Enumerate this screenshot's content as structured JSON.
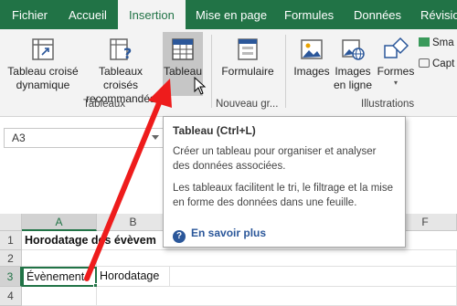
{
  "tabs": [
    {
      "label": "Fichier"
    },
    {
      "label": "Accueil"
    },
    {
      "label": "Insertion"
    },
    {
      "label": "Mise en page"
    },
    {
      "label": "Formules"
    },
    {
      "label": "Données"
    },
    {
      "label": "Révision"
    }
  ],
  "ribbon": {
    "pivot_label_1": "Tableau croisé",
    "pivot_label_2": "dynamique",
    "recommended_label_1": "Tableaux croisés",
    "recommended_label_2": "recommandés",
    "table_label": "Tableau",
    "group_tables": "Tableaux",
    "form_label": "Formulaire",
    "group_new": "Nouveau gr...",
    "images_label": "Images",
    "online_label_1": "Images",
    "online_label_2": "en ligne",
    "shapes_label": "Formes",
    "smartart_label": "Sma",
    "capture_label": "Capt",
    "group_illustrations": "Illustrations",
    "accent_color": "#217346"
  },
  "namebox": {
    "value": "A3"
  },
  "grid": {
    "columns": [
      "A",
      "B",
      "F"
    ],
    "rows": [
      "1",
      "2",
      "3",
      "4"
    ],
    "a1": "Horodatage des évèvem",
    "a3": "Évènement",
    "b3": "Horodatage"
  },
  "tooltip": {
    "title": "Tableau (Ctrl+L)",
    "line1": "Créer un tableau pour organiser et analyser des données associées.",
    "line2": "Les tableaux facilitent le tri, le filtrage et la mise en forme des données dans une feuille.",
    "link": "En savoir plus"
  }
}
